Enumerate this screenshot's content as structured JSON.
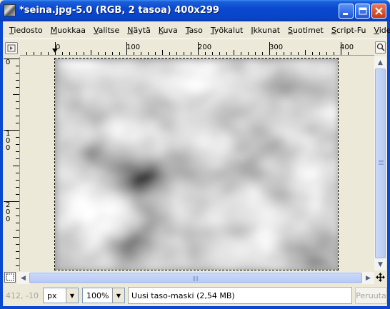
{
  "window": {
    "title": "*seina.jpg-5.0 (RGB, 2 tasoa) 400x299"
  },
  "menu": [
    {
      "label": "Tiedosto"
    },
    {
      "label": "Muokkaa"
    },
    {
      "label": "Valitse"
    },
    {
      "label": "Näytä"
    },
    {
      "label": "Kuva"
    },
    {
      "label": "Taso"
    },
    {
      "label": "Työkalut"
    },
    {
      "label": "Ikkunat"
    },
    {
      "label": "Suotimet"
    },
    {
      "label": "Script-Fu"
    },
    {
      "label": "Video"
    }
  ],
  "rulers": {
    "horizontal_labels": [
      "0",
      "100",
      "200",
      "300",
      "400"
    ],
    "vertical_labels": [
      "0",
      "100",
      "200"
    ]
  },
  "statusbar": {
    "coords": "412, -10",
    "unit": "px",
    "zoom": "100%",
    "message": "Uusi taso-maski (2,54 MB)",
    "cancel_label": "Peruuta"
  },
  "icons": {
    "app": "gimp-image-icon",
    "minimize": "minimize-icon",
    "maximize": "maximize-icon",
    "close": "close-icon",
    "quickmask": "quick-mask-icon",
    "zoom": "zoom-icon",
    "navigate": "navigate-icon"
  }
}
